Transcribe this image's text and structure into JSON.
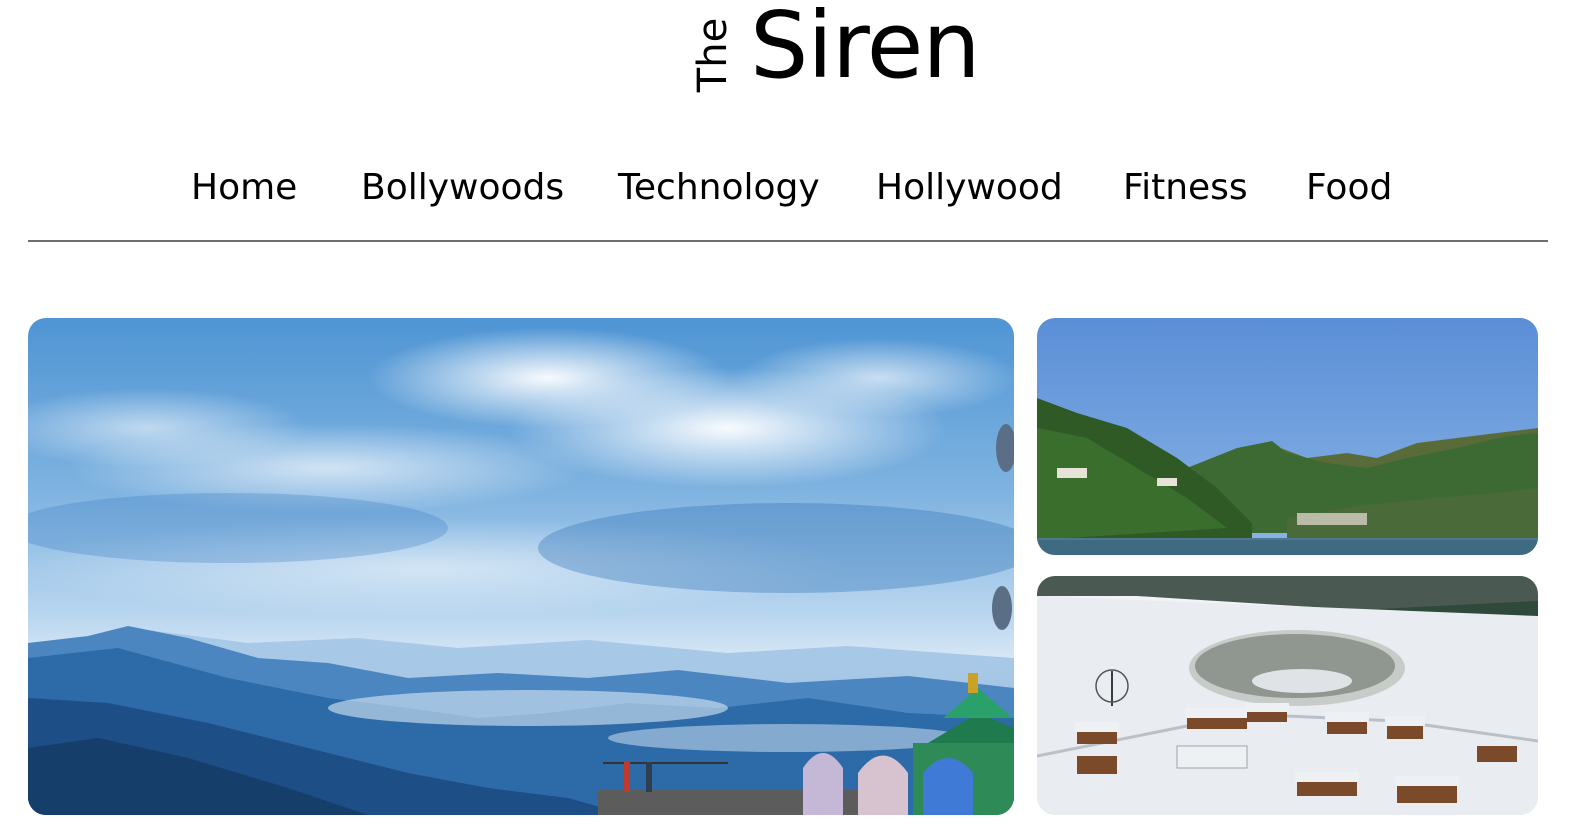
{
  "site": {
    "logo_small": "The",
    "logo_large": "Siren"
  },
  "nav": {
    "items": [
      {
        "label": "Home"
      },
      {
        "label": "Bollywoods"
      },
      {
        "label": "Technology"
      },
      {
        "label": "Hollywood"
      },
      {
        "label": "Fitness"
      },
      {
        "label": "Food"
      }
    ]
  },
  "featured": {
    "main_image": "mountain-valley-sky-photo",
    "side_image_top": "hill-lake-town-photo",
    "side_image_bottom": "snowy-frozen-lake-cottages-photo"
  },
  "colors": {
    "divider": "#6e6e6e",
    "text": "#000000",
    "background": "#ffffff"
  }
}
